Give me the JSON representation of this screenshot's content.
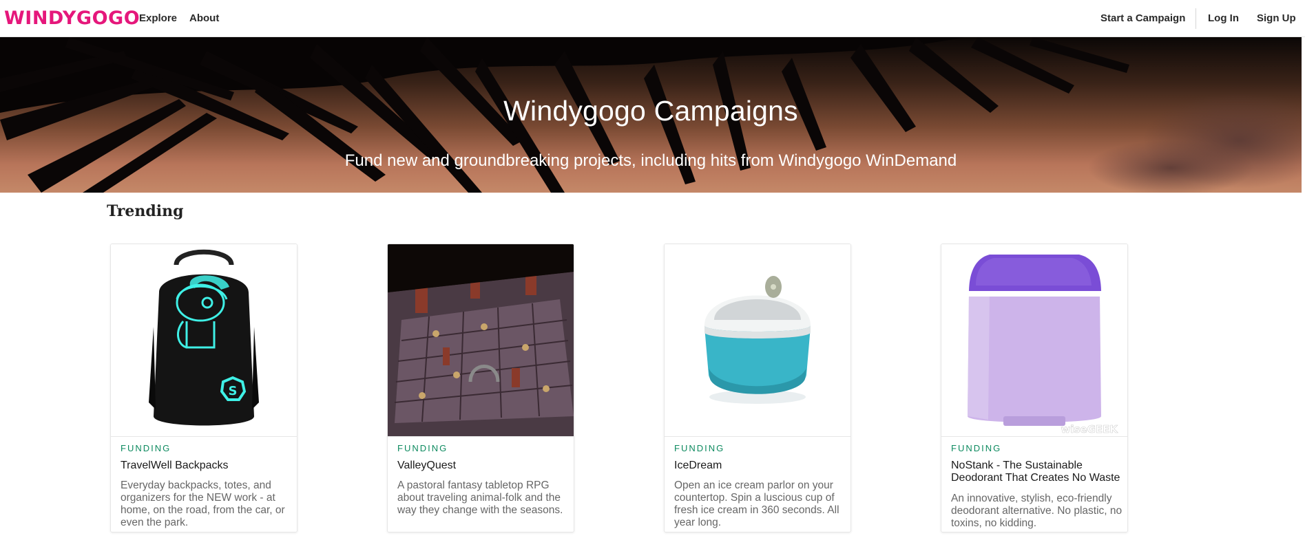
{
  "brand": {
    "logo_text": "WINDYGOGO",
    "accent_color": "#e5177b"
  },
  "nav": {
    "explore": "Explore",
    "about": "About",
    "start_campaign": "Start a Campaign",
    "login": "Log In",
    "signup": "Sign Up"
  },
  "hero": {
    "title": "Windygogo Campaigns",
    "subtitle": "Fund new and groundbreaking projects, including hits from Windygogo WinDemand"
  },
  "trending": {
    "heading": "Trending",
    "status_color": "#0d8a5f",
    "cards": [
      {
        "status": "FUNDING",
        "title": "TravelWell Backpacks",
        "description": "Everyday backpacks, totes, and organizers for the NEW work - at home, on the road, from the car, or even the park.",
        "image": "glowing-backpack"
      },
      {
        "status": "FUNDING",
        "title": "ValleyQuest",
        "description": "A pastoral fantasy tabletop RPG about traveling animal-folk and the way they change with the seasons.",
        "image": "tabletop-rpg-board"
      },
      {
        "status": "FUNDING",
        "title": "IceDream",
        "description": "Open an ice cream parlor on your countertop. Spin a luscious cup of fresh ice cream in 360 seconds. All year long.",
        "image": "ice-cream-maker"
      },
      {
        "status": "FUNDING",
        "title": "NoStank - The Sustainable Deodorant That Creates No Waste",
        "description": "An innovative, stylish, eco-friendly deodorant alternative. No plastic, no toxins, no kidding.",
        "image": "deodorant-stick",
        "watermark": "wiseGEEK"
      }
    ]
  }
}
